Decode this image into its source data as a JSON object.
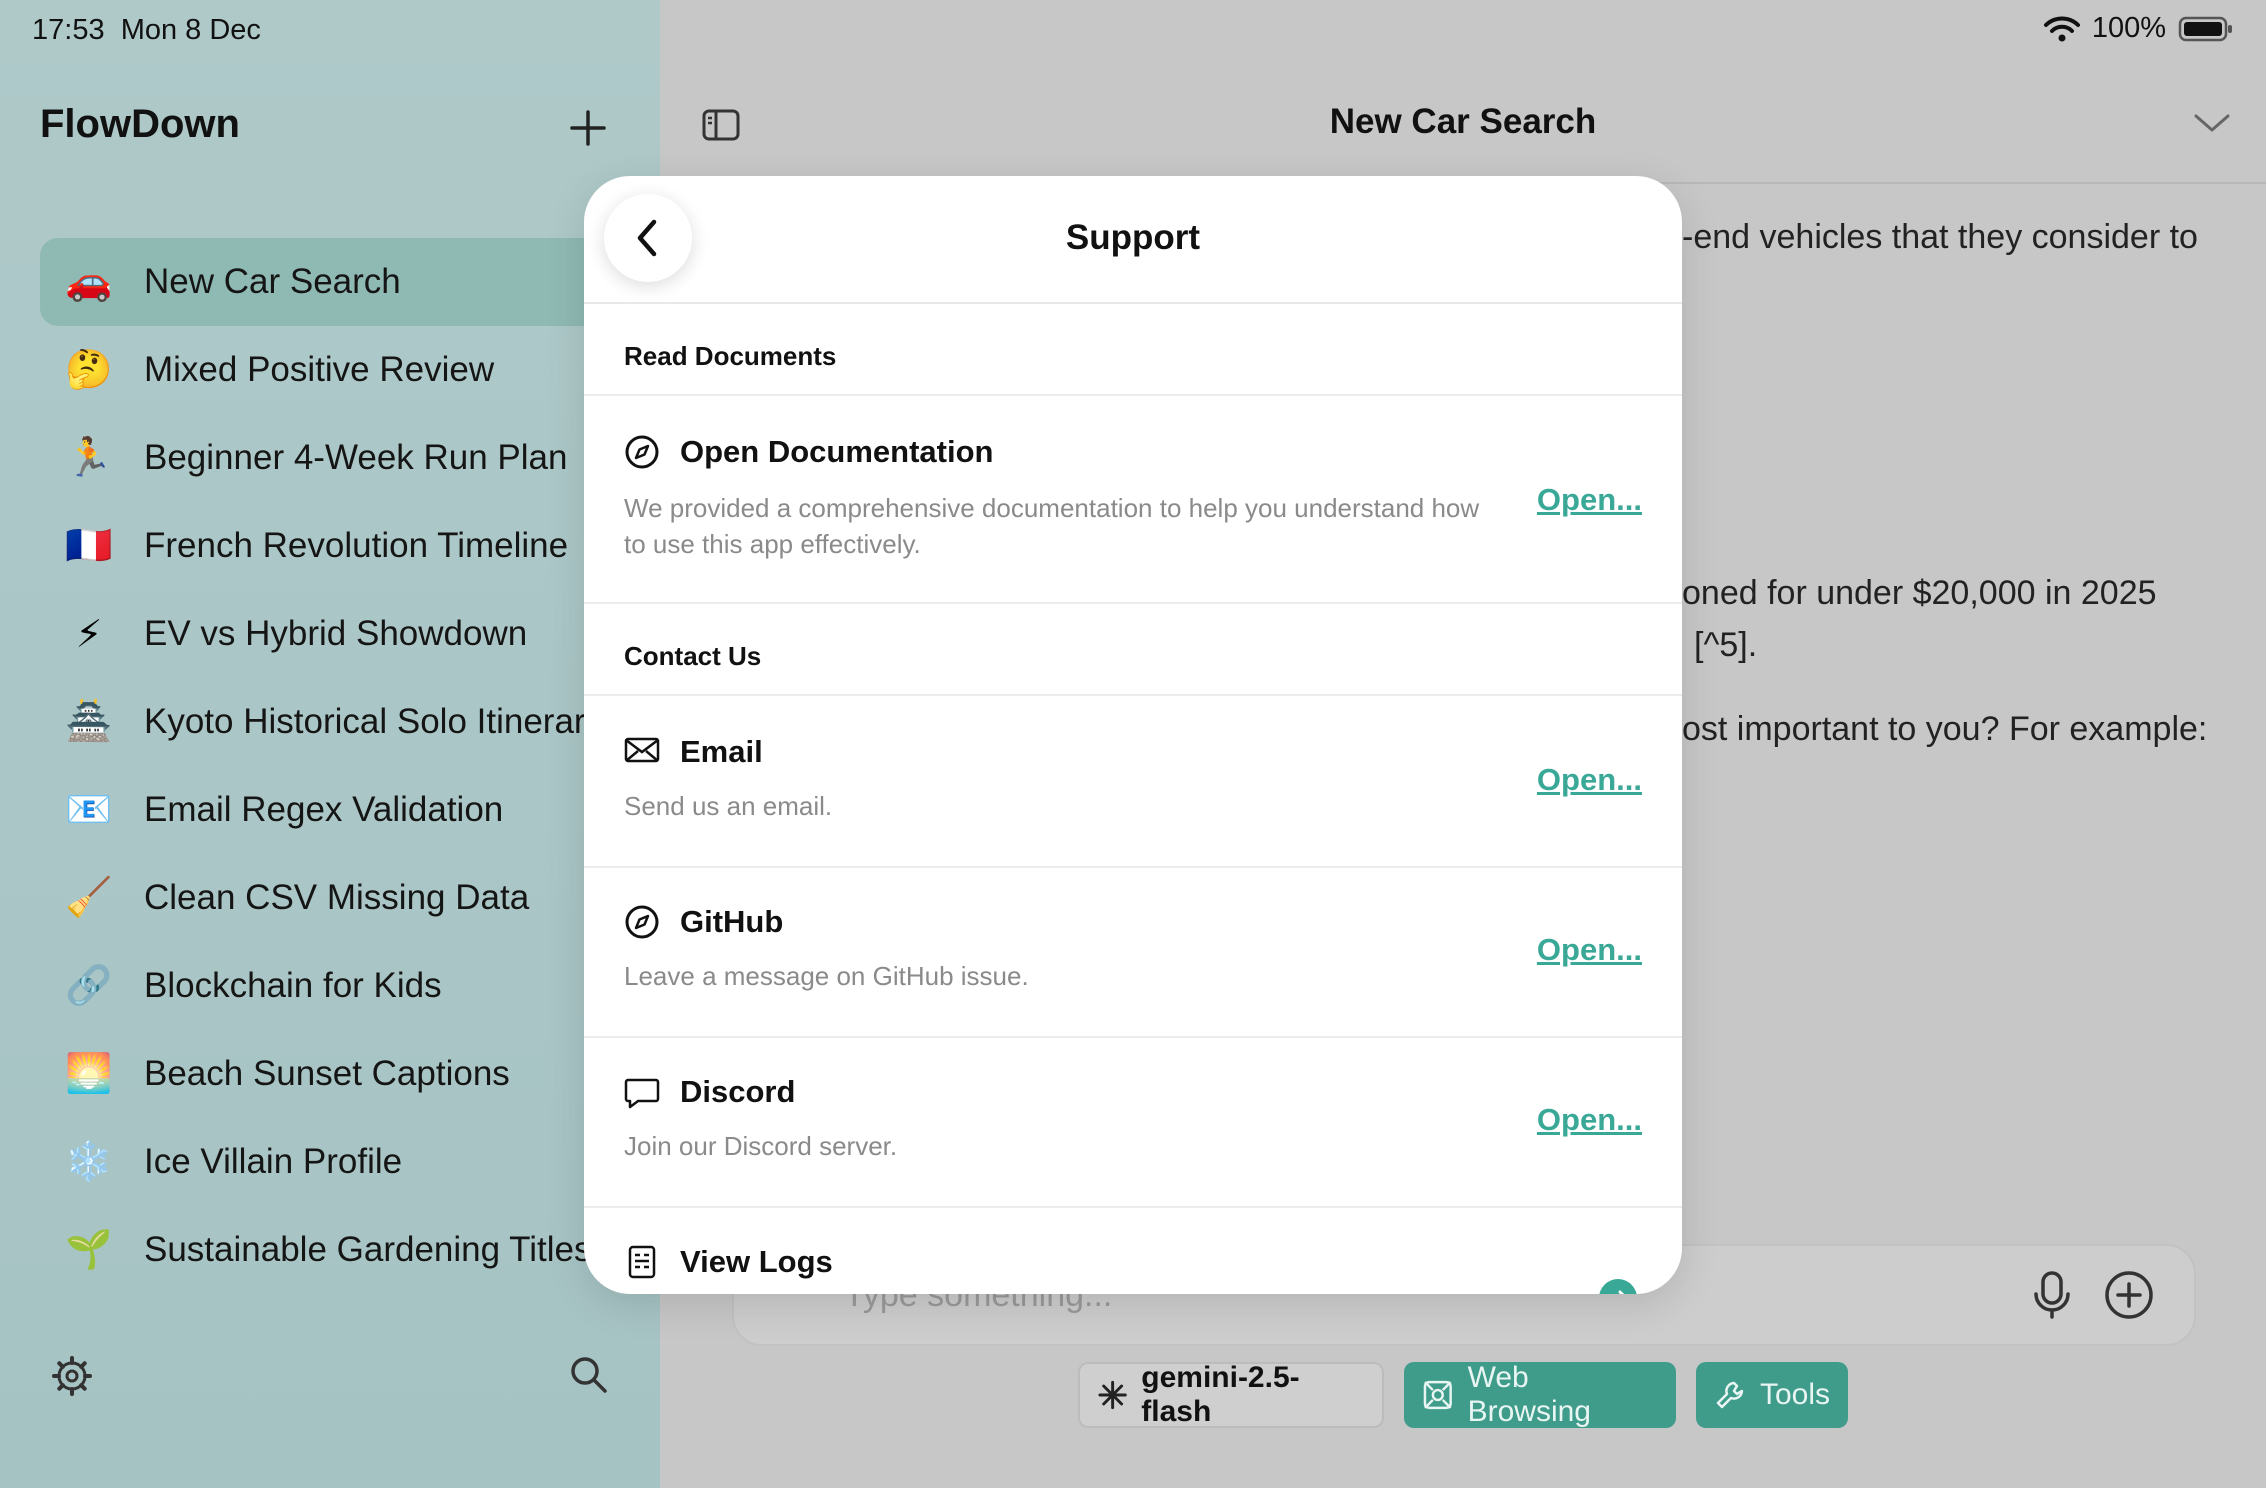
{
  "status": {
    "time": "17:53",
    "date": "Mon 8 Dec",
    "battery": "100%"
  },
  "sidebar": {
    "app_title": "FlowDown",
    "items": [
      {
        "emoji": "🚗",
        "label": "New Car Search"
      },
      {
        "emoji": "🤔",
        "label": "Mixed Positive Review"
      },
      {
        "emoji": "🏃",
        "label": "Beginner 4-Week Run Plan"
      },
      {
        "emoji": "🇫🇷",
        "label": "French Revolution Timeline"
      },
      {
        "emoji": "⚡",
        "label": "EV vs Hybrid Showdown"
      },
      {
        "emoji": "🏯",
        "label": "Kyoto Historical Solo Itinerary"
      },
      {
        "emoji": "📧",
        "label": "Email Regex Validation"
      },
      {
        "emoji": "🧹",
        "label": "Clean CSV Missing Data"
      },
      {
        "emoji": "🔗",
        "label": "Blockchain for Kids"
      },
      {
        "emoji": "🌅",
        "label": "Beach Sunset Captions"
      },
      {
        "emoji": "❄️",
        "label": "Ice Villain Profile"
      },
      {
        "emoji": "🌱",
        "label": "Sustainable Gardening Titles"
      }
    ]
  },
  "main": {
    "title": "New Car Search",
    "message_fragments": [
      "-end vehicles that they consider to",
      "oned for under $20,000 in 2025",
      "[^5].",
      "ost important to you? For example:"
    ],
    "input_placeholder": "Type something...",
    "model": "gemini-2.5-flash",
    "web_browsing_label": "Web Browsing",
    "tools_label": "Tools"
  },
  "modal": {
    "title": "Support",
    "sections": [
      {
        "header": "Read Documents"
      },
      {
        "header": "Contact Us"
      }
    ],
    "rows": [
      {
        "title": "Open Documentation",
        "description": "We provided a comprehensive documentation to help you understand how to use this app effectively.",
        "link": "Open..."
      },
      {
        "title": "Email",
        "description": "Send us an email.",
        "link": "Open..."
      },
      {
        "title": "GitHub",
        "description": "Leave a message on GitHub issue.",
        "link": "Open..."
      },
      {
        "title": "Discord",
        "description": "Join our Discord server.",
        "link": "Open..."
      },
      {
        "title": "View Logs"
      }
    ]
  },
  "colors": {
    "accent": "#3aa897",
    "sidebar_active": "#8fb9b3",
    "pill_green": "#3f9c8a"
  }
}
